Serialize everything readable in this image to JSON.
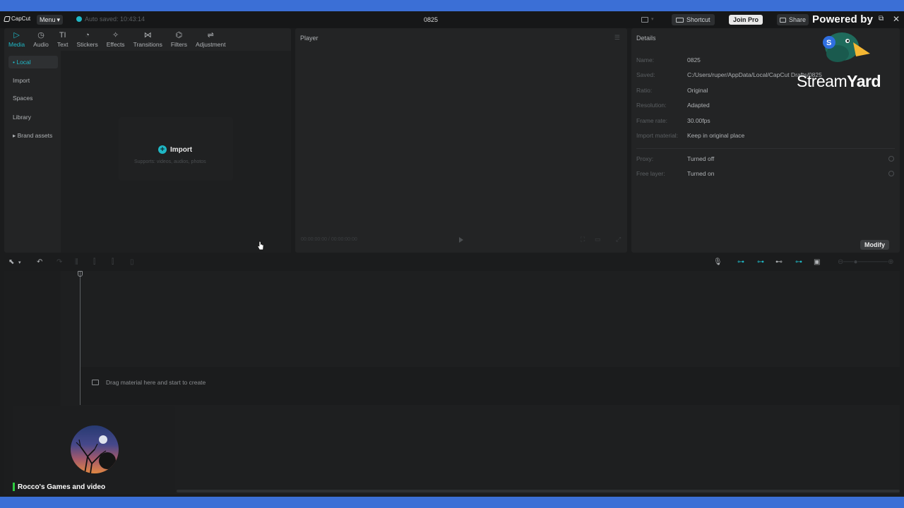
{
  "topbar": {
    "logo": "CapCut",
    "menu_label": "Menu",
    "autosave": "Auto saved: 10:43:14",
    "project_title": "0825",
    "shortcut_label": "Shortcut",
    "joinpro_label": "Join Pro",
    "share_label": "Share",
    "powered_by": "Powered by"
  },
  "tools": [
    {
      "label": "Media",
      "icon": "▷"
    },
    {
      "label": "Audio",
      "icon": "◷"
    },
    {
      "label": "Text",
      "icon": "TI"
    },
    {
      "label": "Stickers",
      "icon": "◔"
    },
    {
      "label": "Effects",
      "icon": "✧"
    },
    {
      "label": "Transitions",
      "icon": "⋈"
    },
    {
      "label": "Filters",
      "icon": "⌬"
    },
    {
      "label": "Adjustment",
      "icon": "⇌"
    }
  ],
  "sidebar": {
    "items": [
      {
        "label": "• Local"
      },
      {
        "label": "Import"
      },
      {
        "label": "Spaces"
      },
      {
        "label": "Library"
      },
      {
        "label": "▸ Brand assets"
      }
    ]
  },
  "media": {
    "import_label": "Import",
    "import_sub": "Supports: videos, audios, photos"
  },
  "player": {
    "title": "Player",
    "timecode": "00:00:00:00 / 00:00:00:00"
  },
  "details": {
    "title": "Details",
    "rows": [
      {
        "label": "Name:",
        "value": "0825"
      },
      {
        "label": "Saved:",
        "value": "C:/Users/ruper/AppData/Local/CapCut Drafts/0825"
      },
      {
        "label": "Ratio:",
        "value": "Original"
      },
      {
        "label": "Resolution:",
        "value": "Adapted"
      },
      {
        "label": "Frame rate:",
        "value": "30.00fps"
      },
      {
        "label": "Import material:",
        "value": "Keep in original place"
      },
      {
        "label": "Proxy:",
        "value": "Turned off"
      },
      {
        "label": "Free layer:",
        "value": "Turned on"
      }
    ],
    "modify_label": "Modify"
  },
  "streamyard": {
    "word_light": "Stream",
    "word_bold": "Yard"
  },
  "timeline": {
    "hint": "Drag material here and start to create"
  },
  "webcam": {
    "name": "Rocco's Games and video"
  },
  "colors": {
    "accent": "#1fb7c5",
    "background": "#1b1c1d",
    "frame": "#3b6fd6"
  }
}
